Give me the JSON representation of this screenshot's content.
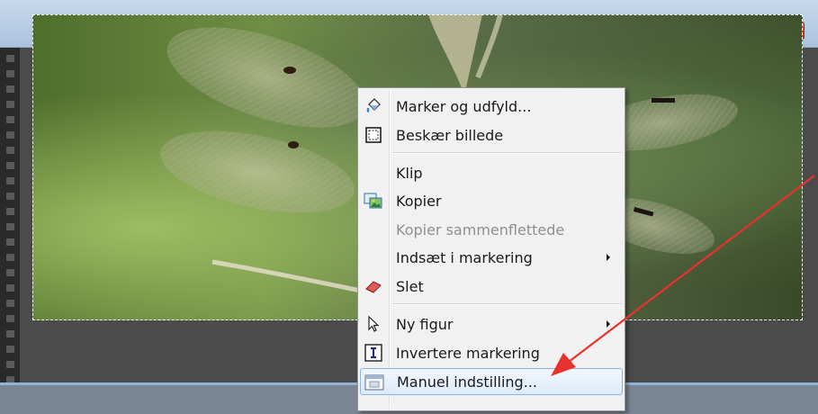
{
  "window": {
    "controls": {
      "minimize_icon": "minimize-icon",
      "maximize_icon": "maximize-icon",
      "close_icon": "close-icon",
      "close_glyph": "✕"
    }
  },
  "canvas": {
    "image_subject_icon": "dragonfly-photo",
    "selection": "marching-ants"
  },
  "context_menu": {
    "items": [
      {
        "label": "Marker og udfyld...",
        "icon": "paint-bucket-icon"
      },
      {
        "label": "Beskær billede",
        "icon": "crop-icon"
      },
      {
        "label": "Klip",
        "icon": ""
      },
      {
        "label": "Kopier",
        "icon": "copy-icon"
      },
      {
        "label": "Kopier sammenflettede",
        "icon": "",
        "disabled": true
      },
      {
        "label": "Indsæt i markering",
        "icon": "",
        "submenu": true
      },
      {
        "label": "Slet",
        "icon": "eraser-icon"
      },
      {
        "label": "Ny figur",
        "icon": "cursor-icon",
        "submenu": true
      },
      {
        "label": "Invertere markering",
        "icon": "invert-selection-icon"
      },
      {
        "label": "Manuel indstilling...",
        "icon": "window-settings-icon",
        "highlighted": true
      }
    ]
  },
  "annotation": {
    "arrow_color": "#e8322d",
    "arrow_icon": "red-arrow-icon"
  },
  "colors": {
    "menu_highlight_border": "#8eb4e4",
    "titlebar": "#b7cde4",
    "close_button": "#c23b22"
  }
}
